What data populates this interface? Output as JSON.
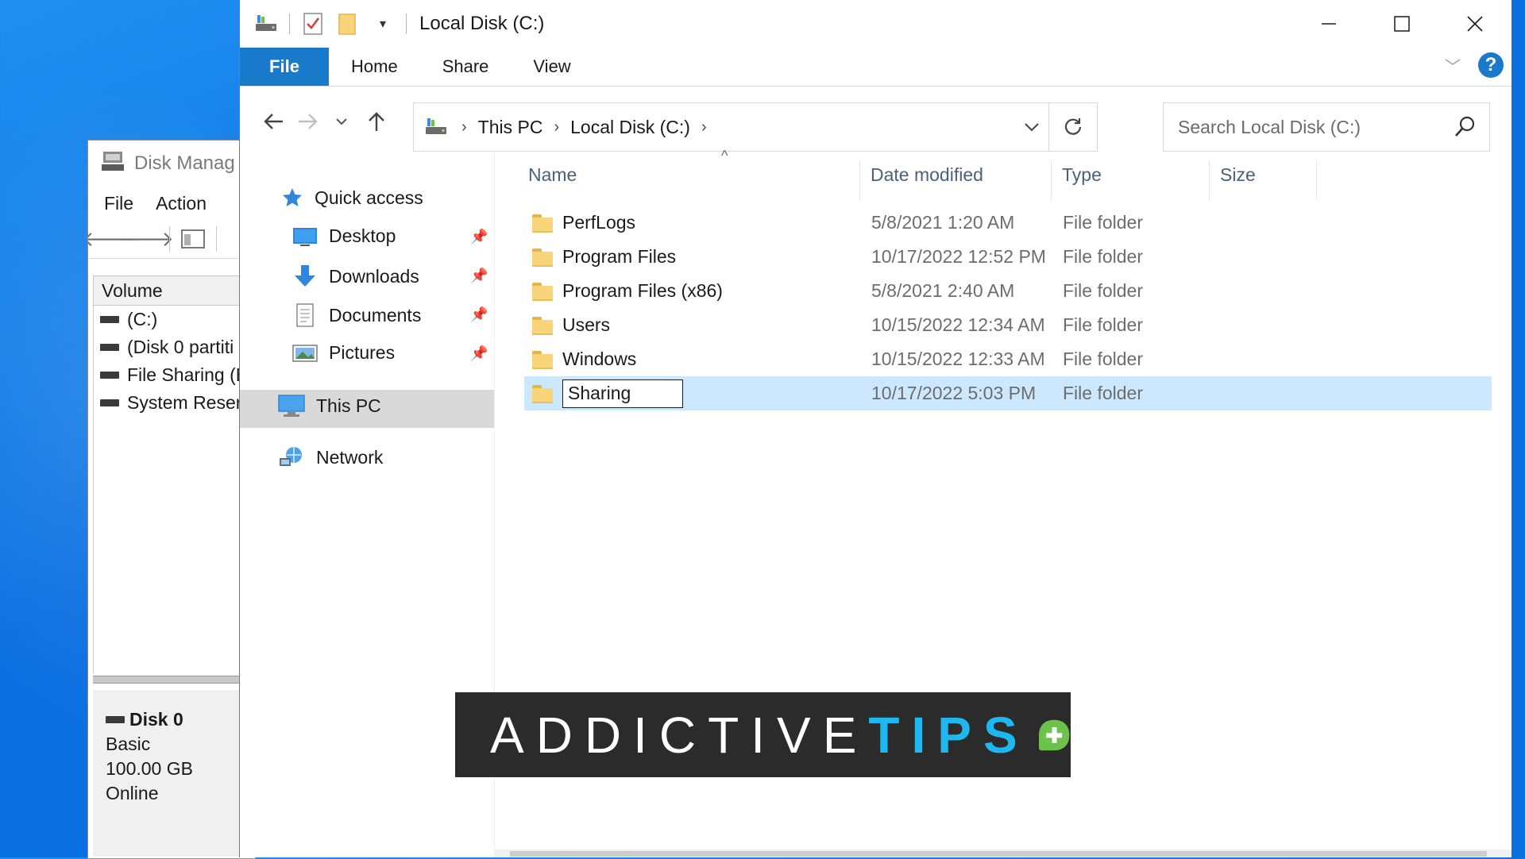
{
  "disk_management": {
    "title": "Disk Manag",
    "menu": [
      "File",
      "Action"
    ],
    "volume_header": "Volume",
    "volumes": [
      "(C:)",
      "(Disk 0 partiti",
      "File Sharing (E",
      "System Reser"
    ],
    "disk": {
      "name": "Disk 0",
      "kind": "Basic",
      "size": "100.00 GB",
      "status": "Online"
    }
  },
  "explorer": {
    "title": "Local Disk (C:)",
    "ribbon_tabs": [
      "File",
      "Home",
      "Share",
      "View"
    ],
    "help_label": "?",
    "breadcrumb": [
      "This PC",
      "Local Disk (C:)"
    ],
    "search_placeholder": "Search Local Disk (C:)",
    "nav_pane": {
      "quick_access": "Quick access",
      "items": [
        "Desktop",
        "Downloads",
        "Documents",
        "Pictures"
      ],
      "this_pc": "This PC",
      "network": "Network"
    },
    "columns": [
      "Name",
      "Date modified",
      "Type",
      "Size"
    ],
    "files": [
      {
        "name": "PerfLogs",
        "date": "5/8/2021 1:20 AM",
        "type": "File folder"
      },
      {
        "name": "Program Files",
        "date": "10/17/2022 12:52 PM",
        "type": "File folder"
      },
      {
        "name": "Program Files (x86)",
        "date": "5/8/2021 2:40 AM",
        "type": "File folder"
      },
      {
        "name": "Users",
        "date": "10/15/2022 12:34 AM",
        "type": "File folder"
      },
      {
        "name": "Windows",
        "date": "10/15/2022 12:33 AM",
        "type": "File folder"
      },
      {
        "name": "Sharing",
        "date": "10/17/2022 5:03 PM",
        "type": "File folder"
      }
    ],
    "selected_row": 5
  },
  "watermark": {
    "word_light": "ADDICTIVE",
    "word_accent": "TIPS"
  },
  "colors": {
    "accent": "#1979ca",
    "selection": "#cce8ff",
    "banner_accent": "#1eb7ef",
    "plus_green": "#6cc24a"
  }
}
